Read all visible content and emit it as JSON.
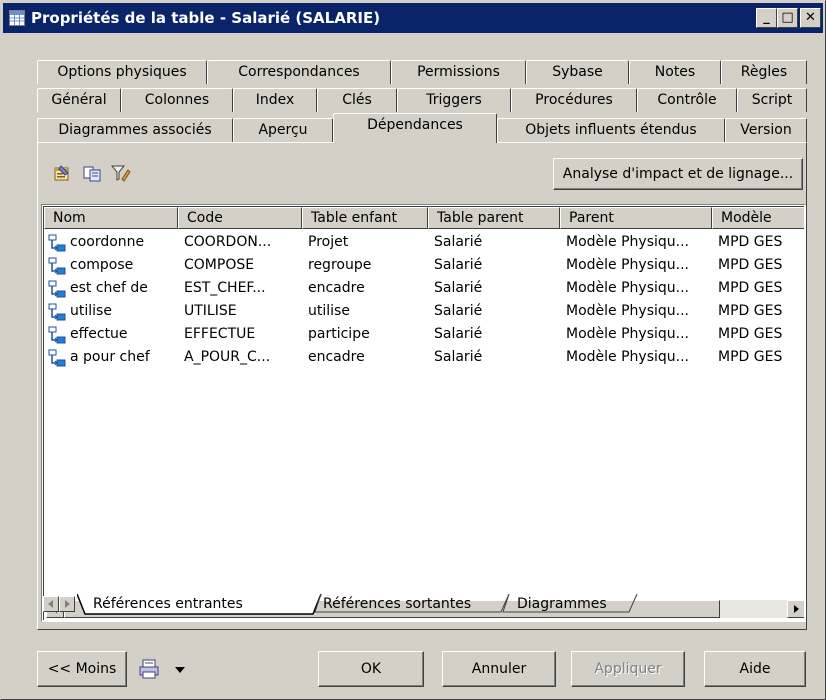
{
  "window": {
    "title": "Propriétés de la table - Salarié (SALARIE)",
    "minimize_glyph": "_",
    "maximize_glyph": "□",
    "close_glyph": "✕"
  },
  "tabs": {
    "row1": [
      "Options physiques",
      "Correspondances",
      "Permissions",
      "Sybase",
      "Notes",
      "Règles"
    ],
    "row2": [
      "Général",
      "Colonnes",
      "Index",
      "Clés",
      "Triggers",
      "Procédures",
      "Contrôle",
      "Script"
    ],
    "row3": [
      "Diagrammes associés",
      "Aperçu",
      "Dépendances",
      "Objets influents étendus",
      "Version"
    ],
    "active": "Dépendances"
  },
  "toolbar": {
    "icons": [
      "properties-icon",
      "copy-icon",
      "filter-icon"
    ],
    "impact_button_label": "Analyse d'impact et de lignage..."
  },
  "list": {
    "columns": [
      "Nom",
      "Code",
      "Table enfant",
      "Table parent",
      "Parent",
      "Modèle"
    ],
    "rows": [
      {
        "nom": "coordonne",
        "code": "COORDON...",
        "enfant": "Projet",
        "parent_table": "Salarié",
        "parent": "Modèle Physiqu...",
        "modele": "MPD GES"
      },
      {
        "nom": "compose",
        "code": "COMPOSE",
        "enfant": "regroupe",
        "parent_table": "Salarié",
        "parent": "Modèle Physiqu...",
        "modele": "MPD GES"
      },
      {
        "nom": "est chef de",
        "code": "EST_CHEF...",
        "enfant": "encadre",
        "parent_table": "Salarié",
        "parent": "Modèle Physiqu...",
        "modele": "MPD GES"
      },
      {
        "nom": "utilise",
        "code": "UTILISE",
        "enfant": "utilise",
        "parent_table": "Salarié",
        "parent": "Modèle Physiqu...",
        "modele": "MPD GES"
      },
      {
        "nom": "effectue",
        "code": "EFFECTUE",
        "enfant": "participe",
        "parent_table": "Salarié",
        "parent": "Modèle Physiqu...",
        "modele": "MPD GES"
      },
      {
        "nom": "a pour chef",
        "code": "A_POUR_C...",
        "enfant": "encadre",
        "parent_table": "Salarié",
        "parent": "Modèle Physiqu...",
        "modele": "MPD GES"
      }
    ],
    "row_icon": "reference-icon"
  },
  "subtabs": {
    "items": [
      "Références entrantes",
      "Références sortantes",
      "Diagrammes"
    ],
    "active": "Références entrantes"
  },
  "buttons": {
    "less": "<< Moins",
    "ok": "OK",
    "cancel": "Annuler",
    "apply": "Appliquer",
    "help": "Aide"
  },
  "colors": {
    "titlebar": "#0a246a",
    "face": "#d4d0c8",
    "window_bg": "#ffffff"
  }
}
